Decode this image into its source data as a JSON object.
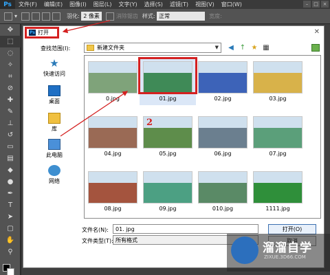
{
  "app": {
    "logo": "Ps"
  },
  "menu": [
    "文件(F)",
    "编辑(E)",
    "图像(I)",
    "图层(L)",
    "文字(Y)",
    "选择(S)",
    "滤镜(T)",
    "视图(V)",
    "窗口(W)"
  ],
  "options": {
    "feather_label": "羽化:",
    "feather_value": "2 像素",
    "antialias": "消除锯齿",
    "style_label": "样式:",
    "style_value": "正常",
    "width_label": "宽度:"
  },
  "dialog": {
    "title": "打开",
    "look_in_label": "查找范围(I):",
    "look_in_value": "新建文件夹",
    "places": [
      "快速访问",
      "桌面",
      "库",
      "此电脑",
      "网络"
    ],
    "files": [
      {
        "name": "0.jpg",
        "color": "#7fa37a"
      },
      {
        "name": "01.jpg",
        "color": "#3f8a57",
        "selected": true
      },
      {
        "name": "02.jpg",
        "color": "#3d63b8"
      },
      {
        "name": "03.jpg",
        "color": "#d8b24a"
      },
      {
        "name": "04.jpg",
        "color": "#9a6a55"
      },
      {
        "name": "05.jpg",
        "color": "#5e8d4b"
      },
      {
        "name": "06.jpg",
        "color": "#6b7f8f"
      },
      {
        "name": "07.jpg",
        "color": "#5b9f7a"
      },
      {
        "name": "08.jpg",
        "color": "#a4543e"
      },
      {
        "name": "09.jpg",
        "color": "#4ca083"
      },
      {
        "name": "010.jpg",
        "color": "#5a8a66"
      },
      {
        "name": "1111.jpg",
        "color": "#2f8f3a"
      }
    ],
    "filename_label": "文件名(N):",
    "filename_value": "01. jpg",
    "filetype_label": "文件类型(T):",
    "filetype_value": "所有格式",
    "open_button": "打开(O)",
    "cancel_button": "取消"
  },
  "annotation": {
    "marker": "2",
    "accent": "#d42020"
  },
  "watermark": {
    "title": "溜溜自学",
    "subtitle": "ZIXUE.3D66.COM"
  }
}
